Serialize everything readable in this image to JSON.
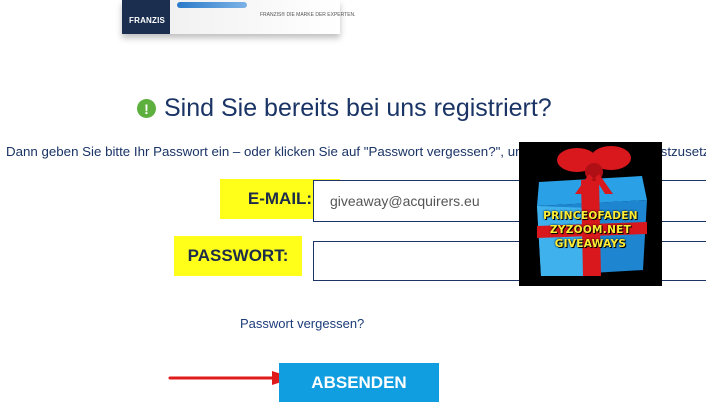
{
  "product": {
    "brand": "FRANZIS",
    "tagline": "FRANZIS® DIE MARKE DER EXPERTEN."
  },
  "heading": {
    "icon": "exclamation-icon",
    "title": "Sind Sie bereits bei uns registriert?"
  },
  "subtitle": "Dann geben Sie bitte Ihr Passwort ein – oder klicken Sie auf \"Passwort vergessen?\", um ein neues Passwort festzusetzen.",
  "form": {
    "email_label": "E-MAIL:",
    "email_value": "giveaway@acquirers.eu",
    "password_label": "PASSWORT:",
    "password_value": "",
    "forgot_link": "Passwort vergessen?",
    "submit_label": "ABSENDEN"
  },
  "watermark": {
    "lines": [
      "PRINCEOFADEN",
      "ZYZOOM.NET",
      "GIVEAWAYS"
    ]
  },
  "colors": {
    "primary_text": "#1a3466",
    "highlight": "#ffff1a",
    "button": "#109ee0",
    "info_icon": "#5db03d",
    "arrow": "#e01b1b"
  }
}
